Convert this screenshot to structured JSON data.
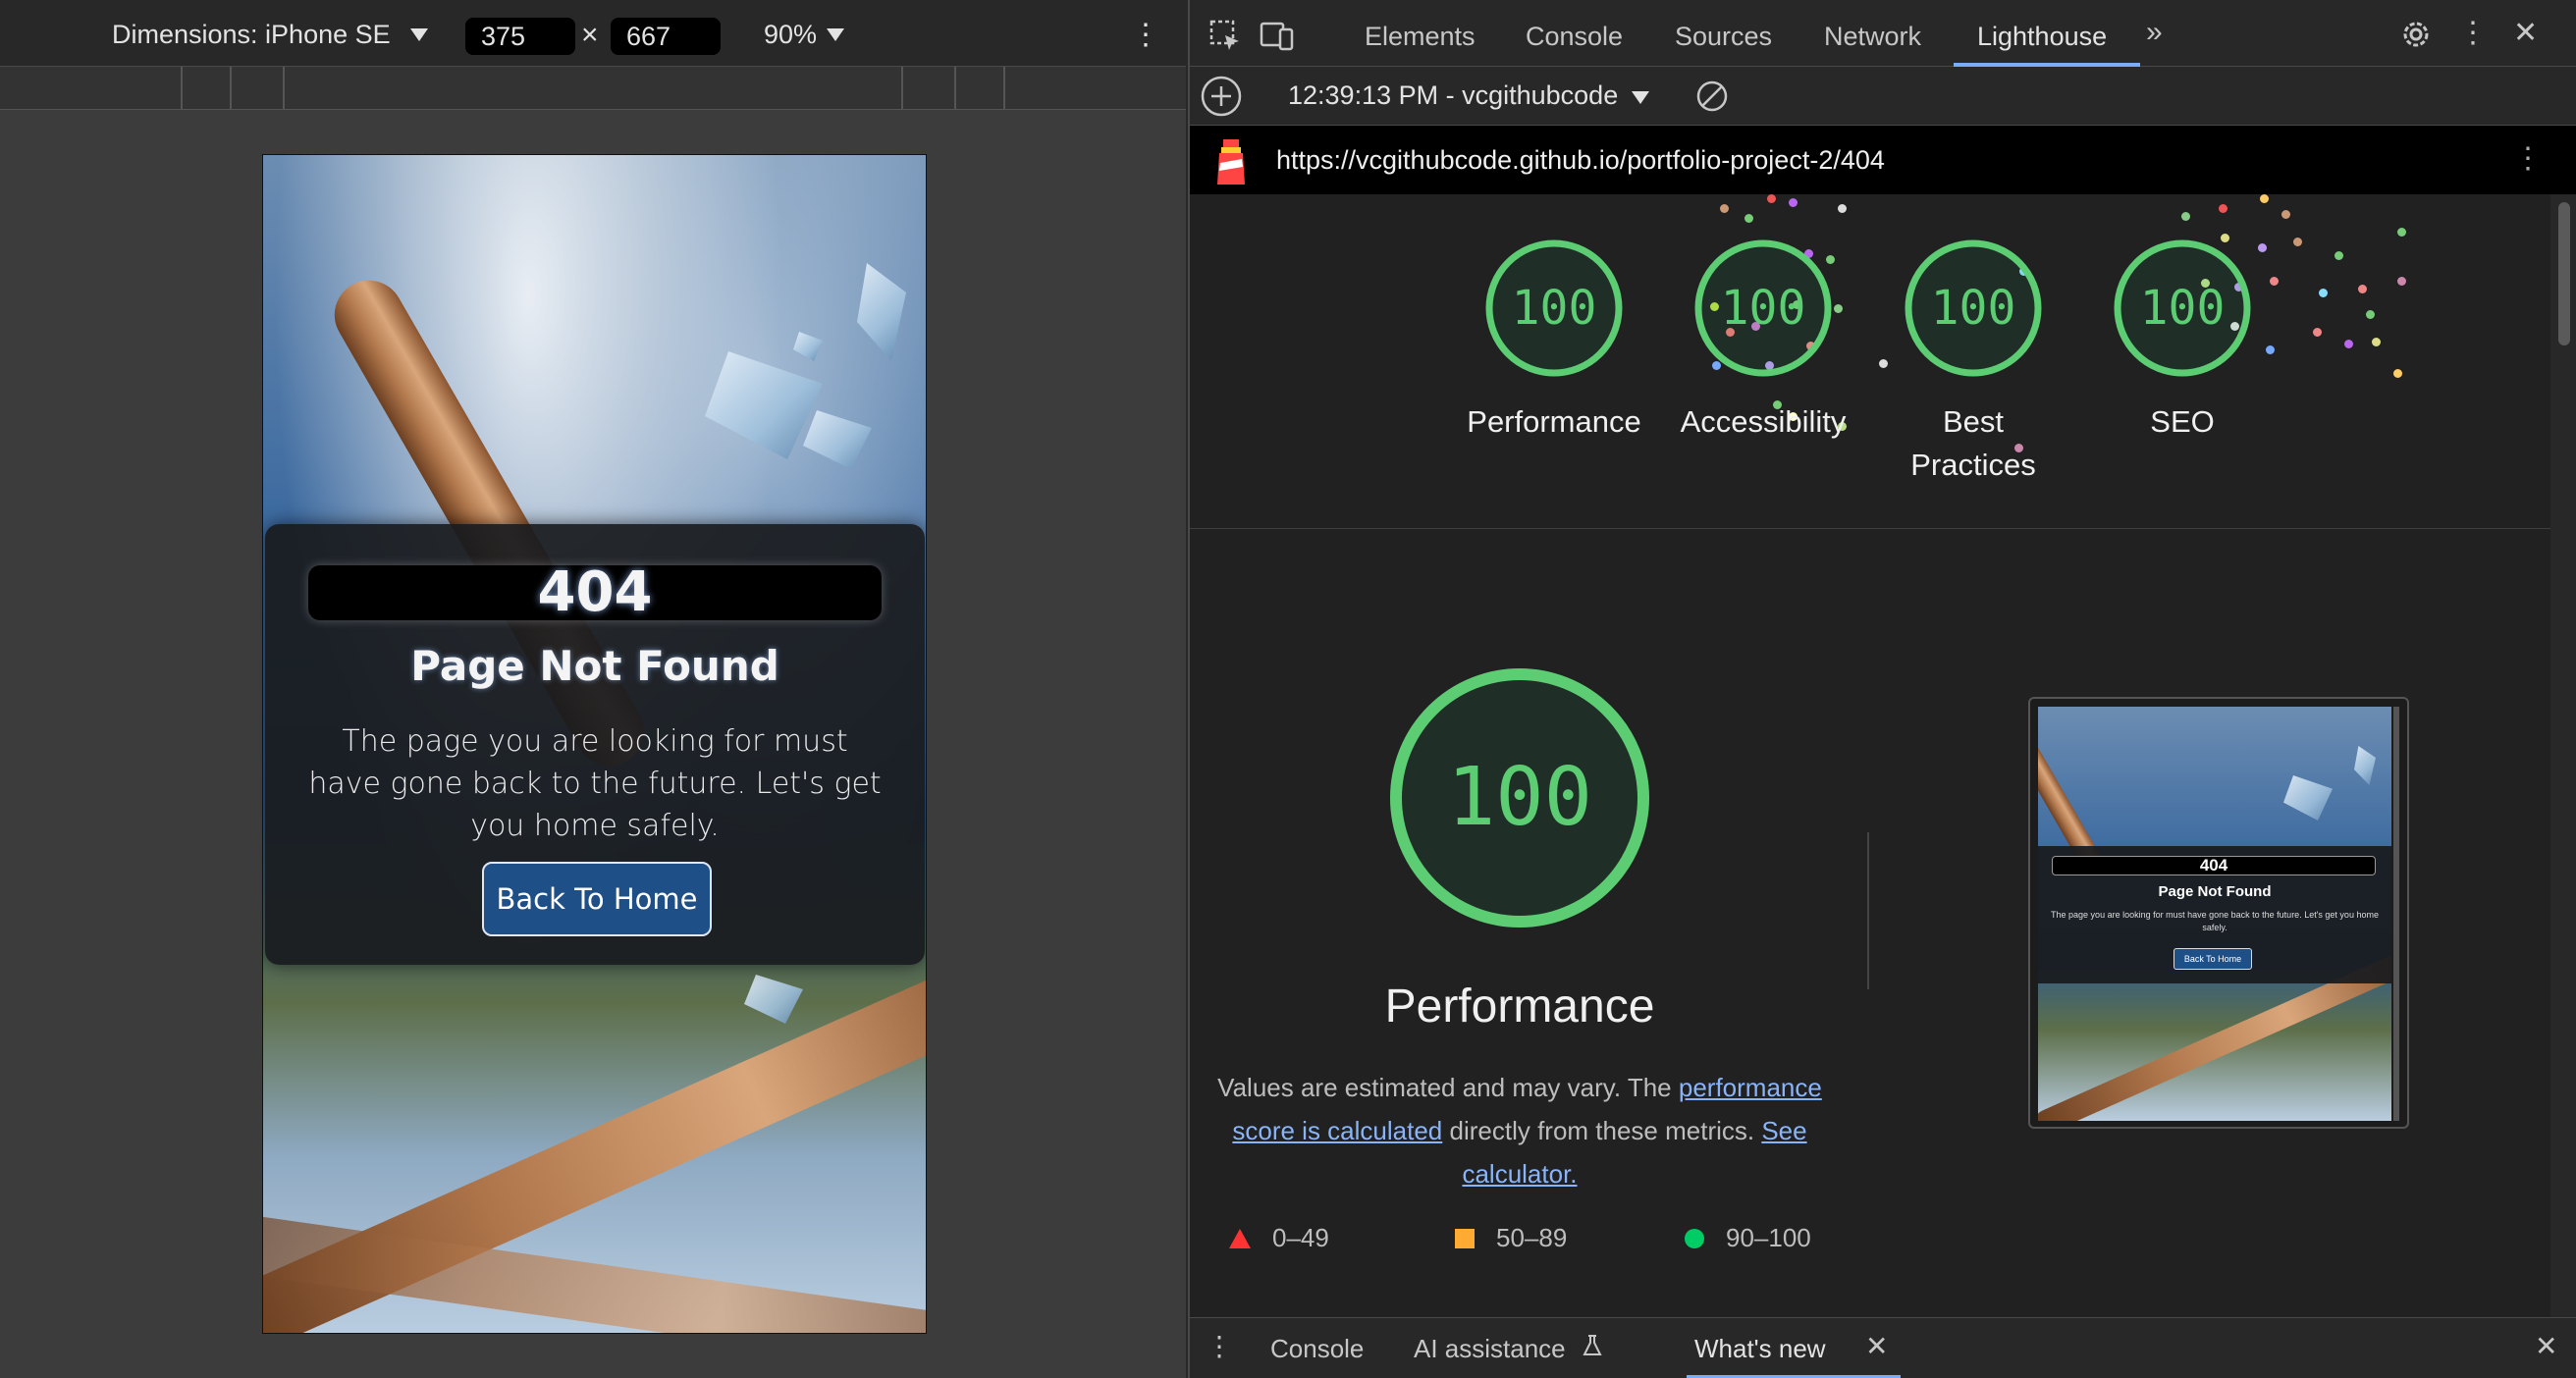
{
  "device_toolbar": {
    "dimensions_label": "Dimensions: iPhone SE",
    "width": "375",
    "times": "×",
    "height": "667",
    "zoom": "90%",
    "more": "⋮"
  },
  "page_404": {
    "code": "404",
    "title": "Page Not Found",
    "description": "The page you are looking for must have gone back to the future. Let's get you home safely.",
    "button": "Back To Home"
  },
  "devtools": {
    "tabs": [
      "Elements",
      "Console",
      "Sources",
      "Network",
      "Lighthouse"
    ],
    "active_tab": "Lighthouse",
    "more_tabs": "»",
    "report_label": "12:39:13 PM - vcgithubcode",
    "url": "https://vcgithubcode.github.io/portfolio-project-2/404"
  },
  "lighthouse": {
    "categories": [
      {
        "score": "100",
        "label": "Performance"
      },
      {
        "score": "100",
        "label": "Accessibility"
      },
      {
        "score": "100",
        "label": "Best Practices"
      },
      {
        "score": "100",
        "label": "SEO"
      }
    ],
    "main_score": "100",
    "main_title": "Performance",
    "desc_part1": "Values are estimated and may vary. The ",
    "desc_link1": "performance score is calculated",
    "desc_part2": " directly from these metrics. ",
    "desc_link2": "See calculator.",
    "thumbnail": {
      "code": "404",
      "title": "Page Not Found",
      "description": "The page you are looking for must have gone back to the future. Let's get you home safely.",
      "button": "Back To Home"
    },
    "legend": [
      "0–49",
      "50–89",
      "90–100"
    ]
  },
  "drawer": {
    "tabs": [
      "Console",
      "AI assistance",
      "What's new"
    ]
  },
  "colors": {
    "pass": "#5ccd73",
    "fail": "#ff3333",
    "average": "#ffaa33",
    "good": "#00cc66",
    "link": "#8ab4f8"
  }
}
